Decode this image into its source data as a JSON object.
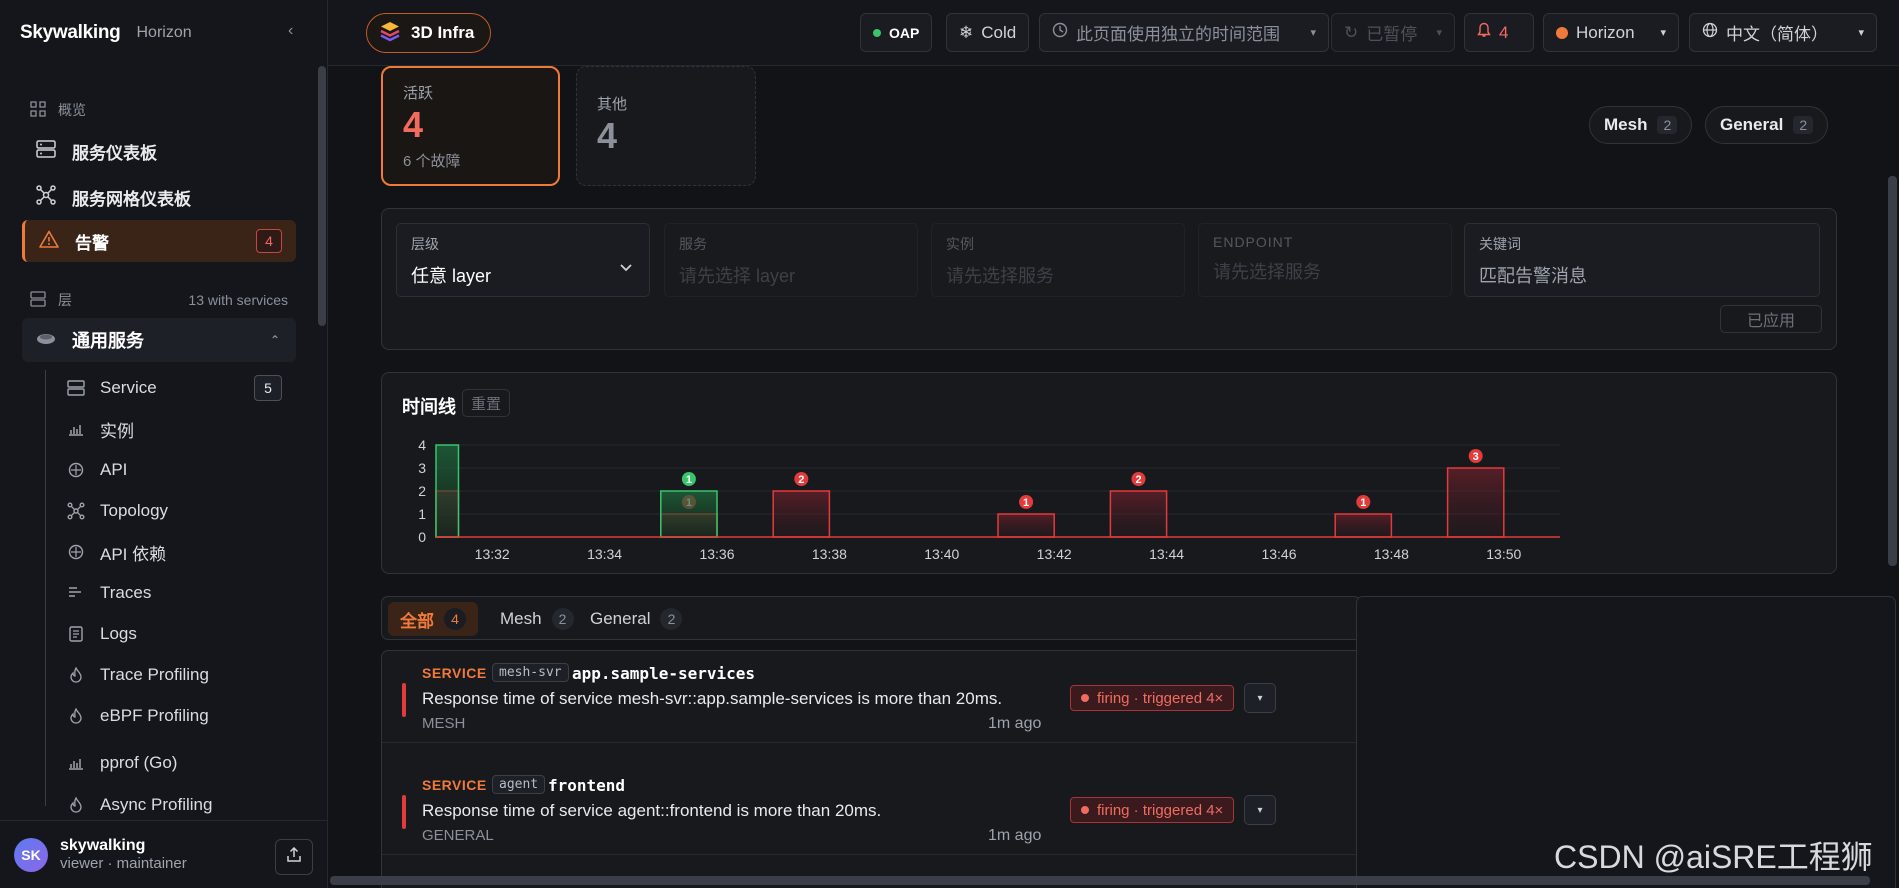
{
  "brand": {
    "logo": "Skywalking",
    "sub": "Horizon",
    "collapse": "‹"
  },
  "sidebar": {
    "overview_label": "概览",
    "items": [
      {
        "label": "服务仪表板",
        "icon": "server-icon"
      },
      {
        "label": "服务网格仪表板",
        "icon": "topology-icon"
      },
      {
        "label": "告警",
        "icon": "alert-triangle-icon",
        "badge": "4"
      }
    ],
    "layers_label": "层",
    "layers_count": "13 with services",
    "group": {
      "label": "通用服务",
      "icon": "general-service-icon",
      "chevron": "⌃"
    },
    "sub_items": [
      {
        "label": "Service",
        "icon": "server-icon",
        "badge": "5"
      },
      {
        "label": "实例",
        "icon": "bar-chart-icon"
      },
      {
        "label": "API",
        "icon": "endpoint-icon"
      },
      {
        "label": "Topology",
        "icon": "topology-icon"
      },
      {
        "label": "API 依赖",
        "icon": "endpoint-icon"
      },
      {
        "label": "Traces",
        "icon": "traces-icon"
      },
      {
        "label": "Logs",
        "icon": "logs-icon"
      },
      {
        "label": "Trace Profiling",
        "icon": "flame-icon"
      },
      {
        "label": "eBPF Profiling",
        "icon": "flame-icon"
      },
      {
        "label": "pprof (Go)",
        "icon": "bar-chart-icon"
      },
      {
        "label": "Async Profiling",
        "icon": "flame-icon"
      }
    ],
    "user": {
      "initials": "SK",
      "name": "skywalking",
      "role": "viewer · maintainer"
    }
  },
  "topbar": {
    "infra_label": "3D Infra",
    "oap_label": "OAP",
    "cold_label": "Cold",
    "time_range_label": "此页面使用独立的时间范围",
    "paused_label": "已暂停",
    "alarm_count": "4",
    "horizon_label": "Horizon",
    "language_label": "中文（简体）",
    "colors": {
      "accent": "#f07a3a",
      "ok": "#3ac46b",
      "danger": "#e23b3b"
    }
  },
  "stats": {
    "active": {
      "label": "活跃",
      "value": "4",
      "sub": "6 个故障"
    },
    "other": {
      "label": "其他",
      "value": "4"
    }
  },
  "chips": [
    {
      "label": "Mesh",
      "count": "2"
    },
    {
      "label": "General",
      "count": "2"
    }
  ],
  "filters": {
    "layer": {
      "label": "层级",
      "value": "任意 layer"
    },
    "service": {
      "label": "服务",
      "placeholder": "请先选择 layer"
    },
    "instance": {
      "label": "实例",
      "placeholder": "请先选择服务"
    },
    "endpoint": {
      "label": "ENDPOINT",
      "placeholder": "请先选择服务"
    },
    "keyword": {
      "label": "关键词",
      "placeholder": "匹配告警消息"
    },
    "applied_label": "已应用"
  },
  "timeline": {
    "title": "时间线",
    "reset_label": "重置"
  },
  "chart_data": {
    "type": "area",
    "title": "时间线",
    "x_ticks": [
      "13:32",
      "13:34",
      "13:36",
      "13:38",
      "13:40",
      "13:42",
      "13:44",
      "13:46",
      "13:48",
      "13:50"
    ],
    "y_ticks": [
      "0",
      "1",
      "2",
      "3",
      "4"
    ],
    "ylim": [
      0,
      4
    ],
    "xlim": [
      "13:31",
      "13:51"
    ],
    "series": [
      {
        "color": "#e23b3b",
        "intervals": [
          {
            "start": "13:31:00",
            "end": "13:31:24",
            "value": 2
          },
          {
            "start": "13:35:00",
            "end": "13:36:00",
            "value": 1
          },
          {
            "start": "13:37:00",
            "end": "13:38:00",
            "value": 2
          },
          {
            "start": "13:41:00",
            "end": "13:42:00",
            "value": 1
          },
          {
            "start": "13:43:00",
            "end": "13:44:00",
            "value": 2
          },
          {
            "start": "13:47:00",
            "end": "13:48:00",
            "value": 1
          },
          {
            "start": "13:49:00",
            "end": "13:50:00",
            "value": 3
          }
        ],
        "markers": [
          {
            "t": "13:35:30",
            "value": 1,
            "label": "1"
          },
          {
            "t": "13:37:30",
            "value": 2,
            "label": "2"
          },
          {
            "t": "13:41:30",
            "value": 1,
            "label": "1"
          },
          {
            "t": "13:43:30",
            "value": 2,
            "label": "2"
          },
          {
            "t": "13:47:30",
            "value": 1,
            "label": "1"
          },
          {
            "t": "13:49:30",
            "value": 3,
            "label": "3"
          }
        ]
      },
      {
        "color": "#3ac46b",
        "intervals": [
          {
            "start": "13:31:00",
            "end": "13:31:24",
            "value": 4
          },
          {
            "start": "13:35:00",
            "end": "13:36:00",
            "value": 2
          }
        ],
        "markers": [
          {
            "t": "13:35:30",
            "value": 2,
            "label": "1"
          }
        ]
      }
    ],
    "grid": true
  },
  "tabs": [
    {
      "label": "全部",
      "count": "4"
    },
    {
      "label": "Mesh",
      "count": "2"
    },
    {
      "label": "General",
      "count": "2"
    }
  ],
  "alarms": [
    {
      "kind": "SERVICE",
      "tag": "mesh-svr",
      "service": "app.sample-services",
      "message": "Response time of service mesh-svr::app.sample-services is more than 20ms.",
      "layer": "MESH",
      "ago": "1m ago",
      "status": "firing · triggered 4×",
      "expand": "▾"
    },
    {
      "kind": "SERVICE",
      "tag": "agent",
      "service": "frontend",
      "message": "Response time of service agent::frontend is more than 20ms.",
      "layer": "GENERAL",
      "ago": "1m ago",
      "status": "firing · triggered 4×",
      "expand": "▾"
    }
  ],
  "watermark": "CSDN @aiSRE工程狮"
}
